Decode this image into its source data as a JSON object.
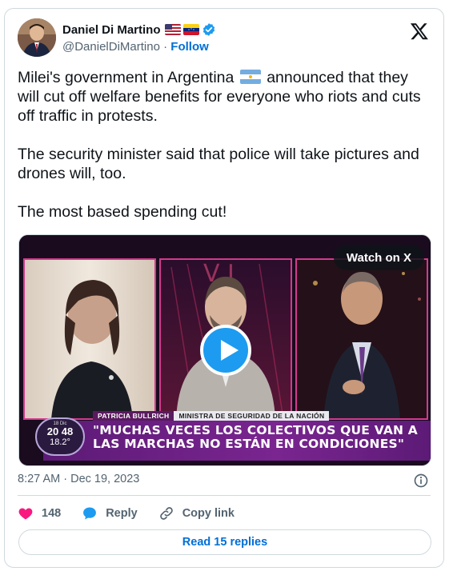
{
  "author": {
    "name": "Daniel Di Martino",
    "handle": "@DanielDiMartino",
    "separator": "·",
    "follow_label": "Follow",
    "flags": [
      "us-flag-icon",
      "venezuela-flag-icon"
    ],
    "verified": true
  },
  "tweet": {
    "line1_before_flag": "Milei's government in Argentina ",
    "line1_after_flag": " announced that they will cut off welfare benefits for everyone who riots and cuts off traffic in protests.",
    "paragraph2": "The security minister said that police will take pictures and drones will, too.",
    "paragraph3": "The most based spending cut!"
  },
  "media": {
    "watch_label": "Watch on X",
    "lower_third": {
      "name": "PATRICIA BULLRICH",
      "role": "MINISTRA DE SEGURIDAD DE LA NACIÓN",
      "headline": "\"MUCHAS VECES LOS COLECTIVOS QUE VAN A LAS MARCHAS NO ESTÁN EN CONDICIONES\"",
      "clock_date": "18 Dic",
      "clock_time": "20 48",
      "clock_temp": "18.2°"
    }
  },
  "meta": {
    "time": "8:27 AM",
    "separator": "·",
    "date": "Dec 19, 2023"
  },
  "actions": {
    "likes": "148",
    "reply_label": "Reply",
    "copy_label": "Copy link"
  },
  "read_replies_label": "Read 15 replies",
  "colors": {
    "accent": "#1d9bf0",
    "link": "#006fd6",
    "like": "#f91880",
    "muted": "#536471",
    "band": "#6a2184"
  }
}
